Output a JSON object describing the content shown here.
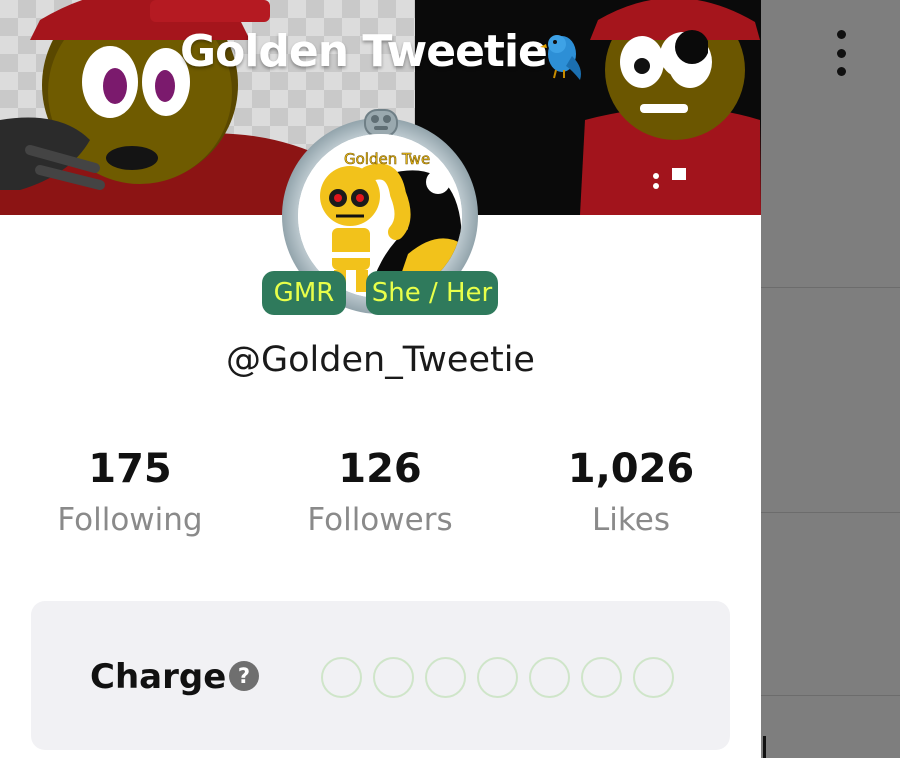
{
  "profile": {
    "display_name": "Golden Tweetie",
    "title_emoji": "bird-emoji",
    "handle": "@Golden_Tweetie",
    "avatar_overlay_text": "Golden Twe",
    "tags": {
      "role": "GMR",
      "pronouns": "She / Her"
    }
  },
  "header": {
    "theme_icon": "moon-icon",
    "menu_icon": "kebab-menu-icon"
  },
  "stats": {
    "following": {
      "value": "175",
      "label": "Following"
    },
    "followers": {
      "value": "126",
      "label": "Followers"
    },
    "likes": {
      "value": "1,026",
      "label": "Likes"
    }
  },
  "charge": {
    "label": "Charge",
    "help_icon": "?",
    "level": 0,
    "max": 7
  },
  "colors": {
    "tag_bg": "#2f7a5c",
    "tag_text": "#e8ff4a",
    "charge_card_bg": "#f1f1f4",
    "charge_dot_border": "#cfe5c9",
    "overlay_dim": "#7e7e7e"
  }
}
